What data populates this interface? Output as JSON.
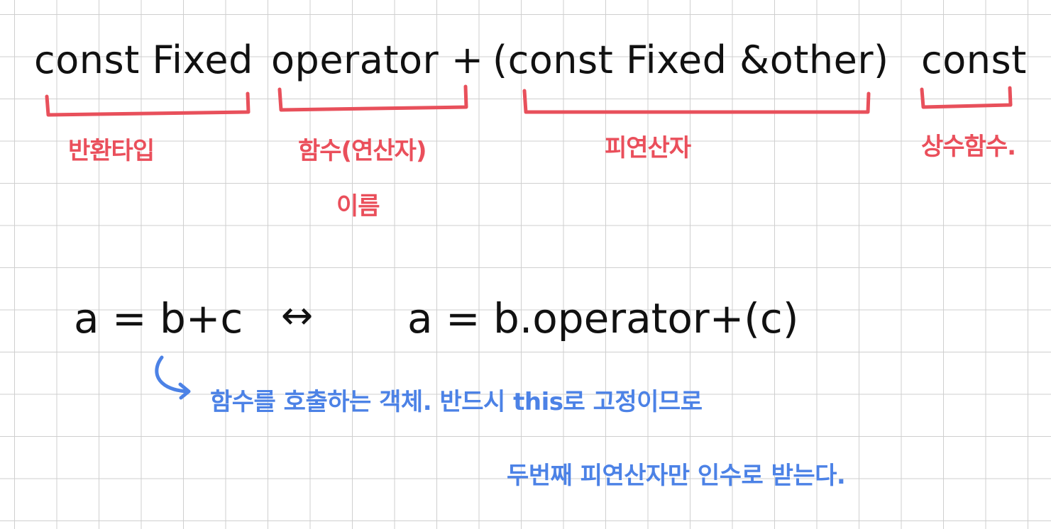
{
  "code_line": {
    "return_type": "const Fixed",
    "function_name": "operator +",
    "parameter": "(const Fixed &other)",
    "qualifier": "const"
  },
  "red_annotations": {
    "return_type_label": "반환타입",
    "function_name_label_line1": "함수(연산자)",
    "function_name_label_line2": "이름",
    "operand_label": "피연산자",
    "const_function_label": "상수함수."
  },
  "equation": {
    "left": "a = b+c",
    "arrow": "↔",
    "right": "a = b.operator+(c)"
  },
  "blue_annotations": {
    "line1": "함수를 호출하는 객체. 반드시 this로 고정이므로",
    "line2": "두번째 피연산자만 인수로 받는다."
  },
  "colors": {
    "ink": "#111111",
    "red": "#e8505b",
    "blue": "#4c82e6",
    "grid": "#cfcfcf"
  }
}
